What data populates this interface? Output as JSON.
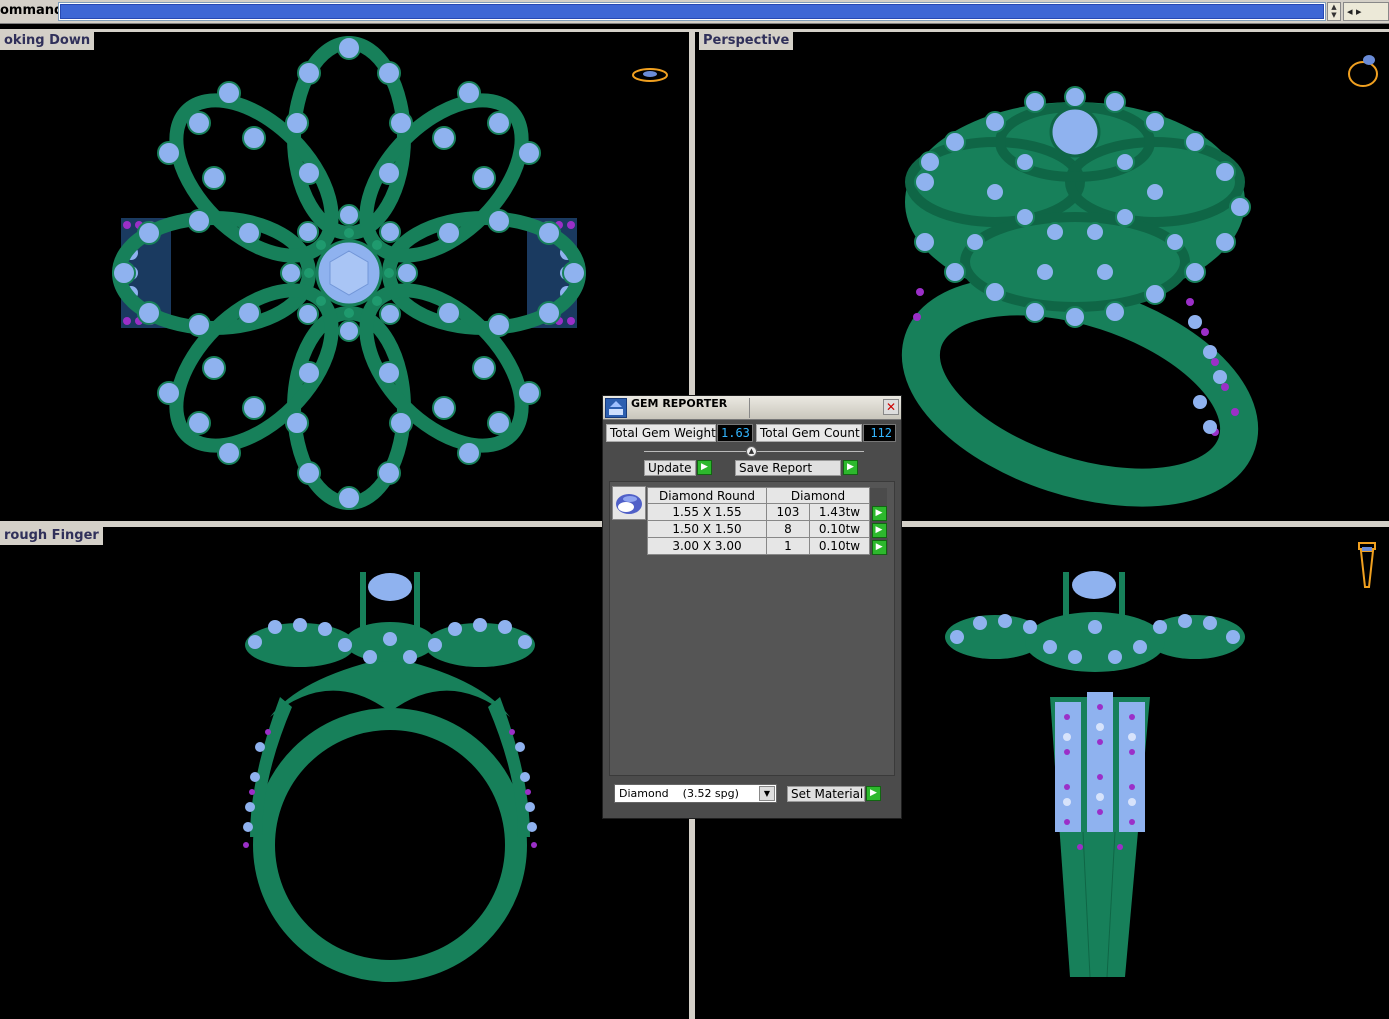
{
  "command_bar": {
    "label": "ommand:",
    "value": ""
  },
  "viewports": {
    "top_left": {
      "label": "oking Down"
    },
    "top_right": {
      "label": "Perspective"
    },
    "bottom_left": {
      "label": "rough Finger"
    },
    "bottom_right": {
      "label": ""
    }
  },
  "gem_reporter": {
    "title": "GEM REPORTER",
    "total_gem_weight_label": "Total Gem Weight",
    "total_gem_weight_value": "1.63",
    "total_gem_count_label": "Total Gem Count",
    "total_gem_count_value": "112",
    "update_label": "Update",
    "save_report_label": "Save Report",
    "table": {
      "headers": [
        "Diamond Round",
        "Diamond"
      ],
      "rows": [
        {
          "size": "1.55 X 1.55",
          "count": "103",
          "weight": "1.43tw"
        },
        {
          "size": "1.50 X 1.50",
          "count": "8",
          "weight": "0.10tw"
        },
        {
          "size": "3.00 X 3.00",
          "count": "1",
          "weight": "0.10tw"
        }
      ]
    },
    "material_selected": "Diamond    (3.52 spg)",
    "set_material_label": "Set Material"
  },
  "colors": {
    "metal": "#17805a",
    "gem": "#8fb2ef",
    "accent_gem": "#9b2fc8",
    "background": "#000000",
    "dialog_bg": "#4b4b4b",
    "value_text": "#33b6ff"
  },
  "icons": [
    "close-icon",
    "gem-reporter-icon",
    "arrow-right-icon",
    "chevron-down-icon",
    "view-cube-icon"
  ]
}
